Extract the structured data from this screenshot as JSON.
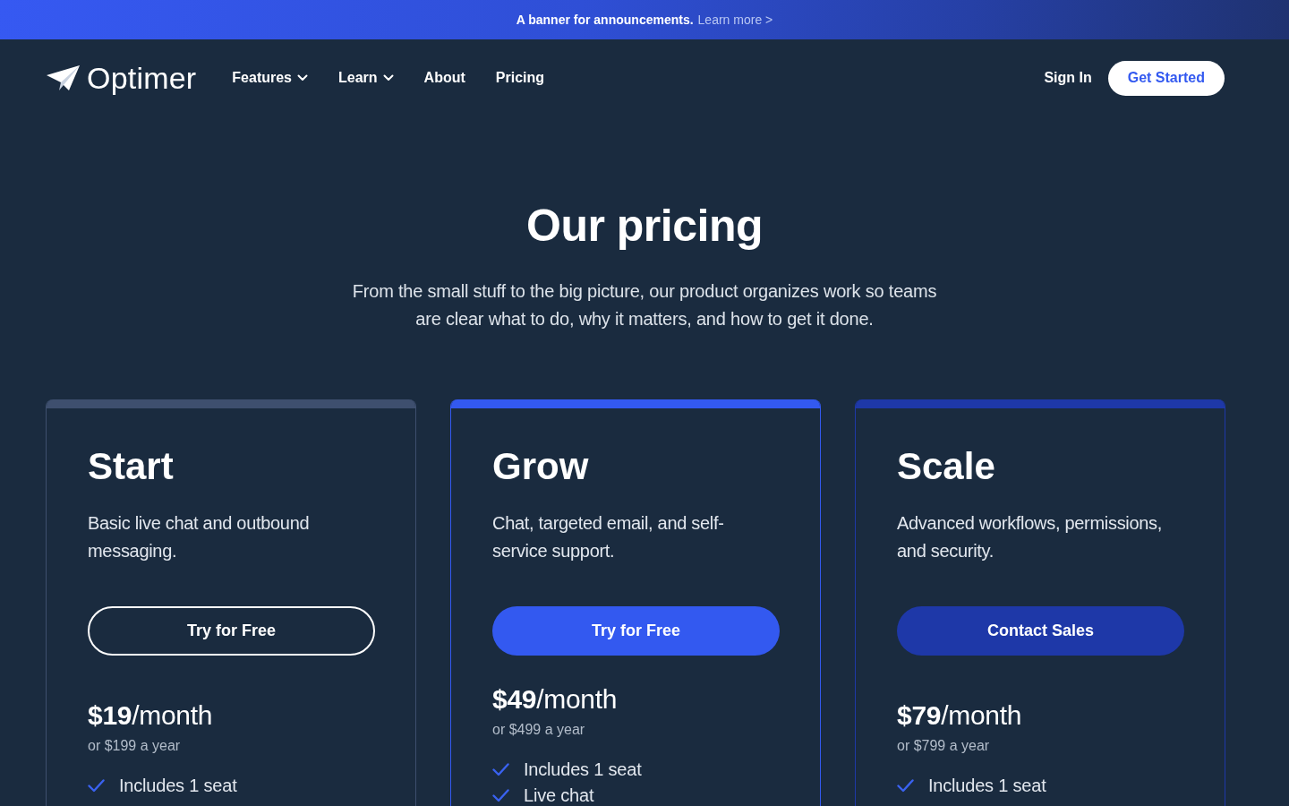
{
  "banner": {
    "text": "A banner for announcements.",
    "link": "Learn more >"
  },
  "nav": {
    "logo": "Optimer",
    "links": [
      {
        "label": "Features",
        "dropdown": true
      },
      {
        "label": "Learn",
        "dropdown": true
      },
      {
        "label": "About",
        "dropdown": false
      },
      {
        "label": "Pricing",
        "dropdown": false
      }
    ],
    "sign_in": "Sign In",
    "cta": "Get Started"
  },
  "hero": {
    "title": "Our pricing",
    "subtitle": "From the small stuff to the big picture, our product organizes work so teams are clear what to do, why it matters, and how to get it done."
  },
  "plans": [
    {
      "name": "Start",
      "color": "#3e4f6e",
      "description": "Basic live chat and outbound messaging.",
      "button": {
        "label": "Try for Free",
        "kind": "outline"
      },
      "price": "**$19**/month",
      "yearly": "or $199 a year",
      "features": [
        "Includes 1 seat"
      ]
    },
    {
      "name": "Grow",
      "color": "#3359f0",
      "description": "Chat, targeted email, and self-service support.",
      "button": {
        "label": "Try for Free",
        "kind": "solid"
      },
      "price": "**$49**/month",
      "yearly": "or $499 a year",
      "features": [
        "Includes 1 seat",
        "Live chat"
      ]
    },
    {
      "name": "Scale",
      "color": "#1e38a8",
      "description": "Advanced workflows, permissions, and security.",
      "button": {
        "label": "Contact Sales",
        "kind": "solid"
      },
      "price": "**$79**/month",
      "yearly": "or $799 a year",
      "features": [
        "Includes 1 seat"
      ]
    }
  ]
}
